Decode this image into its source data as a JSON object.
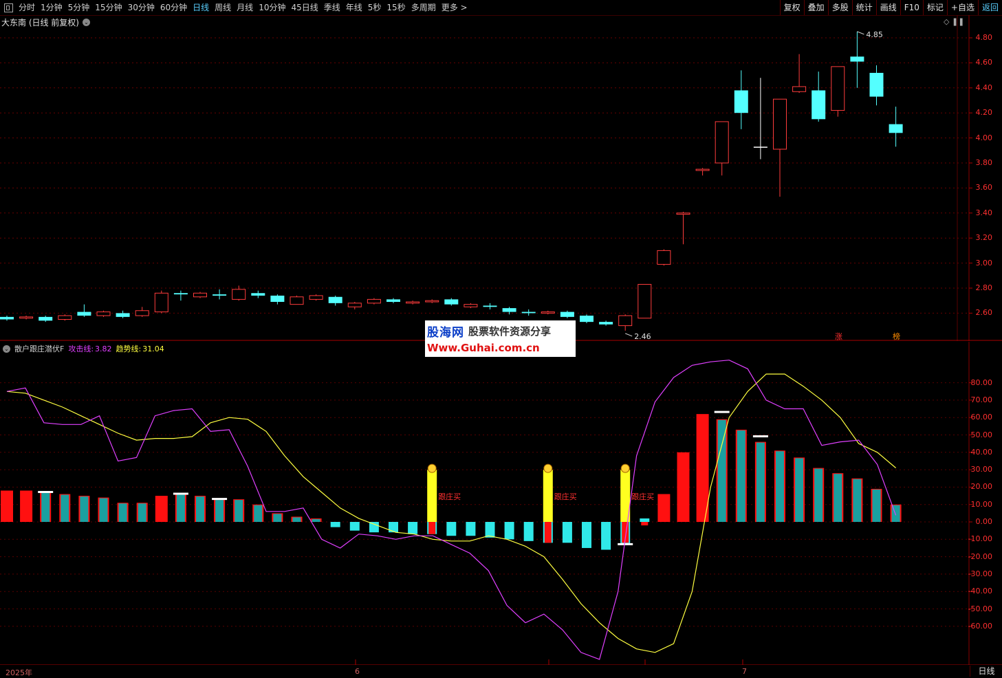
{
  "toolbar": {
    "periods": [
      "分时",
      "1分钟",
      "5分钟",
      "15分钟",
      "30分钟",
      "60分钟",
      "日线",
      "周线",
      "月线",
      "10分钟",
      "45日线",
      "季线",
      "年线",
      "5秒",
      "15秒",
      "多周期",
      "更多 >"
    ],
    "active_period": "日线",
    "actions": [
      "复权",
      "叠加",
      "多股",
      "统计",
      "画线",
      "F10",
      "标记",
      "+自选",
      "返回"
    ]
  },
  "main_chart": {
    "title": "大东南 (日线 前复权)",
    "price_ticks": [
      "4.80",
      "4.60",
      "4.40",
      "4.20",
      "4.00",
      "3.80",
      "3.60",
      "3.40",
      "3.20",
      "3.00",
      "2.80",
      "2.60"
    ],
    "high_label": "4.85",
    "low_label": "2.46",
    "marks": {
      "zhang": "涨",
      "bang": "榜"
    },
    "colors": {
      "up": "#ff3c3c",
      "down": "#54ffff",
      "grid": "#8a0000"
    }
  },
  "indicator": {
    "name": "散户跟庄潜伏F",
    "attack_label": "攻击线:",
    "attack_value": "3.82",
    "trend_label": "趋势线:",
    "trend_value": "31.04",
    "ticks": [
      "80.00",
      "70.00",
      "60.00",
      "50.00",
      "40.00",
      "30.00",
      "20.00",
      "10.00",
      "0.00",
      "-10.00",
      "-20.00",
      "-30.00",
      "-40.00",
      "-50.00",
      "-60.00"
    ],
    "buy_signal": "跟庄买",
    "colors": {
      "attack": "#e040ff",
      "trend": "#ffff40",
      "bar_red": "#ff1010",
      "bar_teal": "#1aa0a0",
      "bar_cyan": "#30e8e8"
    }
  },
  "date_axis": {
    "labels": [
      "2025年",
      "6",
      "7"
    ],
    "period": "日线"
  },
  "watermark": {
    "logo": "股海网",
    "tag": "股票软件资源分享",
    "url": "Www.Guhai.com.cn"
  },
  "chart_data": [
    {
      "type": "candlestick",
      "title": "大东南 (日线 前复权)",
      "ylim": [
        2.42,
        4.88
      ],
      "candles": [
        {
          "o": 2.57,
          "c": 2.55,
          "h": 2.58,
          "l": 2.54
        },
        {
          "o": 2.56,
          "c": 2.57,
          "h": 2.58,
          "l": 2.55
        },
        {
          "o": 2.57,
          "c": 2.54,
          "h": 2.58,
          "l": 2.53
        },
        {
          "o": 2.55,
          "c": 2.58,
          "h": 2.59,
          "l": 2.54
        },
        {
          "o": 2.61,
          "c": 2.58,
          "h": 2.67,
          "l": 2.57
        },
        {
          "o": 2.58,
          "c": 2.61,
          "h": 2.62,
          "l": 2.57
        },
        {
          "o": 2.6,
          "c": 2.57,
          "h": 2.62,
          "l": 2.56
        },
        {
          "o": 2.58,
          "c": 2.62,
          "h": 2.65,
          "l": 2.57
        },
        {
          "o": 2.61,
          "c": 2.76,
          "h": 2.78,
          "l": 2.6
        },
        {
          "o": 2.76,
          "c": 2.75,
          "h": 2.78,
          "l": 2.7
        },
        {
          "o": 2.73,
          "c": 2.76,
          "h": 2.77,
          "l": 2.72
        },
        {
          "o": 2.75,
          "c": 2.74,
          "h": 2.79,
          "l": 2.71
        },
        {
          "o": 2.71,
          "c": 2.79,
          "h": 2.82,
          "l": 2.7
        },
        {
          "o": 2.76,
          "c": 2.74,
          "h": 2.78,
          "l": 2.72
        },
        {
          "o": 2.74,
          "c": 2.69,
          "h": 2.75,
          "l": 2.67
        },
        {
          "o": 2.67,
          "c": 2.73,
          "h": 2.74,
          "l": 2.67
        },
        {
          "o": 2.71,
          "c": 2.74,
          "h": 2.75,
          "l": 2.7
        },
        {
          "o": 2.73,
          "c": 2.68,
          "h": 2.74,
          "l": 2.66
        },
        {
          "o": 2.65,
          "c": 2.68,
          "h": 2.69,
          "l": 2.63
        },
        {
          "o": 2.68,
          "c": 2.71,
          "h": 2.72,
          "l": 2.67
        },
        {
          "o": 2.71,
          "c": 2.69,
          "h": 2.72,
          "l": 2.68
        },
        {
          "o": 2.68,
          "c": 2.69,
          "h": 2.7,
          "l": 2.67
        },
        {
          "o": 2.69,
          "c": 2.7,
          "h": 2.71,
          "l": 2.68
        },
        {
          "o": 2.71,
          "c": 2.67,
          "h": 2.72,
          "l": 2.66
        },
        {
          "o": 2.65,
          "c": 2.67,
          "h": 2.68,
          "l": 2.64
        },
        {
          "o": 2.66,
          "c": 2.65,
          "h": 2.68,
          "l": 2.63
        },
        {
          "o": 2.64,
          "c": 2.61,
          "h": 2.65,
          "l": 2.59
        },
        {
          "o": 2.61,
          "c": 2.6,
          "h": 2.63,
          "l": 2.58
        },
        {
          "o": 2.6,
          "c": 2.61,
          "h": 2.62,
          "l": 2.59
        },
        {
          "o": 2.61,
          "c": 2.57,
          "h": 2.62,
          "l": 2.56
        },
        {
          "o": 2.58,
          "c": 2.53,
          "h": 2.59,
          "l": 2.52
        },
        {
          "o": 2.53,
          "c": 2.51,
          "h": 2.54,
          "l": 2.5
        },
        {
          "o": 2.5,
          "c": 2.58,
          "h": 2.59,
          "l": 2.46
        },
        {
          "o": 2.56,
          "c": 2.83,
          "h": 2.83,
          "l": 2.56
        },
        {
          "o": 2.99,
          "c": 3.1,
          "h": 3.11,
          "l": 2.98
        },
        {
          "o": 3.39,
          "c": 3.4,
          "h": 3.41,
          "l": 3.15
        },
        {
          "o": 3.74,
          "c": 3.75,
          "h": 3.76,
          "l": 3.7
        },
        {
          "o": 3.8,
          "c": 4.13,
          "h": 4.13,
          "l": 3.7
        },
        {
          "o": 4.38,
          "c": 4.2,
          "h": 4.54,
          "l": 4.07
        },
        {
          "o": 3.93,
          "c": 3.93,
          "h": 4.48,
          "l": 3.83
        },
        {
          "o": 3.91,
          "c": 4.31,
          "h": 4.31,
          "l": 3.53
        },
        {
          "o": 4.37,
          "c": 4.41,
          "h": 4.67,
          "l": 4.36
        },
        {
          "o": 4.38,
          "c": 4.15,
          "h": 4.53,
          "l": 4.13
        },
        {
          "o": 4.22,
          "c": 4.57,
          "h": 4.57,
          "l": 4.17
        },
        {
          "o": 4.65,
          "c": 4.61,
          "h": 4.85,
          "l": 4.4
        },
        {
          "o": 4.52,
          "c": 4.33,
          "h": 4.58,
          "l": 4.26
        },
        {
          "o": 4.11,
          "c": 4.04,
          "h": 4.25,
          "l": 3.93
        }
      ]
    },
    {
      "type": "bar",
      "title": "散户跟庄潜伏F",
      "ylim": [
        -80,
        95
      ],
      "bars": [
        {
          "v": 18,
          "k": "red"
        },
        {
          "v": 18,
          "k": "red"
        },
        {
          "v": 17,
          "k": "rt",
          "cap": 17
        },
        {
          "v": 16,
          "k": "rt"
        },
        {
          "v": 15,
          "k": "rt"
        },
        {
          "v": 14,
          "k": "rt"
        },
        {
          "v": 11,
          "k": "rt"
        },
        {
          "v": 11,
          "k": "rt"
        },
        {
          "v": 15,
          "k": "red"
        },
        {
          "v": 16,
          "k": "rt",
          "cap": 16
        },
        {
          "v": 15,
          "k": "rt"
        },
        {
          "v": 13,
          "k": "rt",
          "cap": 13
        },
        {
          "v": 13,
          "k": "rt"
        },
        {
          "v": 10,
          "k": "rt"
        },
        {
          "v": 5,
          "k": "rt"
        },
        {
          "v": 3,
          "k": "rt"
        },
        {
          "v": 2,
          "k": "rt"
        },
        {
          "v": -3,
          "k": "cyan"
        },
        {
          "v": -5,
          "k": "cyan"
        },
        {
          "v": -6,
          "k": "cyan"
        },
        {
          "v": -6,
          "k": "cyan"
        },
        {
          "v": -7,
          "k": "cyan"
        },
        {
          "v": -7,
          "k": "cyan",
          "sig": 30,
          "red": -7
        },
        {
          "v": -8,
          "k": "cyan"
        },
        {
          "v": -8,
          "k": "cyan"
        },
        {
          "v": -9,
          "k": "cyan"
        },
        {
          "v": -10,
          "k": "cyan"
        },
        {
          "v": -11,
          "k": "cyan"
        },
        {
          "v": -12,
          "k": "cyan",
          "sig": 30,
          "red": -12
        },
        {
          "v": -12,
          "k": "cyan"
        },
        {
          "v": -15,
          "k": "cyan"
        },
        {
          "v": -16,
          "k": "cyan"
        },
        {
          "v": -13,
          "k": "cyan",
          "sig": 30,
          "red": -12,
          "cap": -13
        },
        {
          "v": 2,
          "k": "cyan",
          "red": -2
        },
        {
          "v": 16,
          "k": "red"
        },
        {
          "v": 40,
          "k": "red"
        },
        {
          "v": 62,
          "k": "red"
        },
        {
          "v": 59,
          "k": "rt",
          "cap": 63
        },
        {
          "v": 53,
          "k": "rt"
        },
        {
          "v": 46,
          "k": "rt",
          "cap": 49
        },
        {
          "v": 41,
          "k": "rt"
        },
        {
          "v": 37,
          "k": "rt"
        },
        {
          "v": 31,
          "k": "rt"
        },
        {
          "v": 28,
          "k": "rt"
        },
        {
          "v": 25,
          "k": "rt"
        },
        {
          "v": 19,
          "k": "rt"
        },
        {
          "v": 10,
          "k": "rt"
        }
      ],
      "attack": [
        75,
        77,
        57,
        56,
        56,
        61,
        35,
        37,
        61,
        64,
        65,
        52,
        53,
        32,
        6,
        6,
        8,
        -10,
        -15,
        -7,
        -8,
        -10,
        -8,
        -8,
        -13,
        -18,
        -28,
        -48,
        -58,
        -53,
        -62,
        -75,
        -79,
        -40,
        38,
        69,
        83,
        90,
        92,
        93,
        88,
        70,
        65,
        65,
        44,
        46,
        47,
        33,
        3.82
      ],
      "trend": [
        75,
        74,
        70,
        66,
        61,
        56,
        51,
        47,
        48,
        48,
        49,
        57,
        60,
        59,
        52,
        38,
        26,
        17,
        8,
        2,
        -2,
        -6,
        -7,
        -10,
        -11,
        -11,
        -8,
        -10,
        -14,
        -20,
        -33,
        -47,
        -58,
        -67,
        -73,
        -75,
        -70,
        -40,
        20,
        60,
        75,
        85,
        85,
        78,
        70,
        60,
        45,
        40,
        31.04
      ]
    }
  ]
}
